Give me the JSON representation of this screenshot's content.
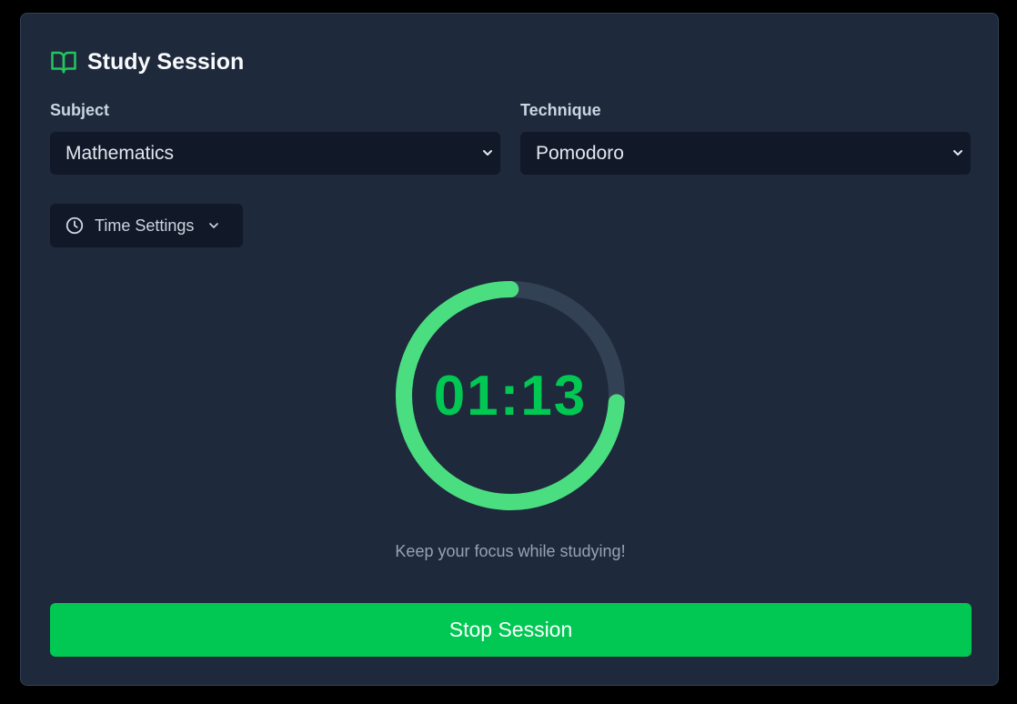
{
  "header": {
    "title": "Study Session",
    "icon": "open-book-icon"
  },
  "subject": {
    "label": "Subject",
    "selected": "Mathematics"
  },
  "technique": {
    "label": "Technique",
    "selected": "Pomodoro"
  },
  "time_settings": {
    "label": "Time Settings",
    "icon": "clock-icon"
  },
  "timer": {
    "display": "01:13",
    "progress_fraction": 0.74
  },
  "message": "Keep your focus while studying!",
  "stop_button": {
    "label": "Stop Session"
  },
  "colors": {
    "accent": "#00c853",
    "ring": "#4ade80",
    "track": "#334155",
    "card": "#1e293b",
    "input_bg": "#111827"
  }
}
